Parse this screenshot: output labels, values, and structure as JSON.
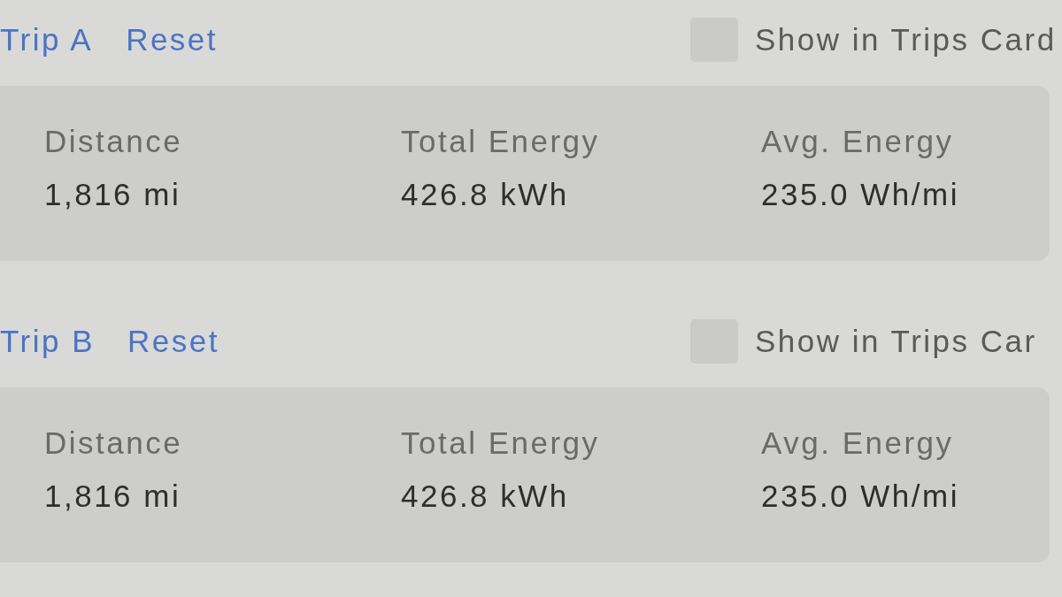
{
  "trips": [
    {
      "title": "Trip A",
      "reset_label": "Reset",
      "show_in_trips_card": {
        "label": "Show in Trips Card",
        "checked": false
      },
      "stats": [
        {
          "label": "Distance",
          "value": "1,816 mi"
        },
        {
          "label": "Total Energy",
          "value": "426.8 kWh"
        },
        {
          "label": "Avg. Energy",
          "value": "235.0 Wh/mi"
        }
      ]
    },
    {
      "title": "Trip B",
      "reset_label": "Reset",
      "show_in_trips_card": {
        "label": "Show in Trips Car",
        "checked": false
      },
      "stats": [
        {
          "label": "Distance",
          "value": "1,816 mi"
        },
        {
          "label": "Total Energy",
          "value": "426.8 kWh"
        },
        {
          "label": "Avg. Energy",
          "value": "235.0 Wh/mi"
        }
      ]
    }
  ]
}
